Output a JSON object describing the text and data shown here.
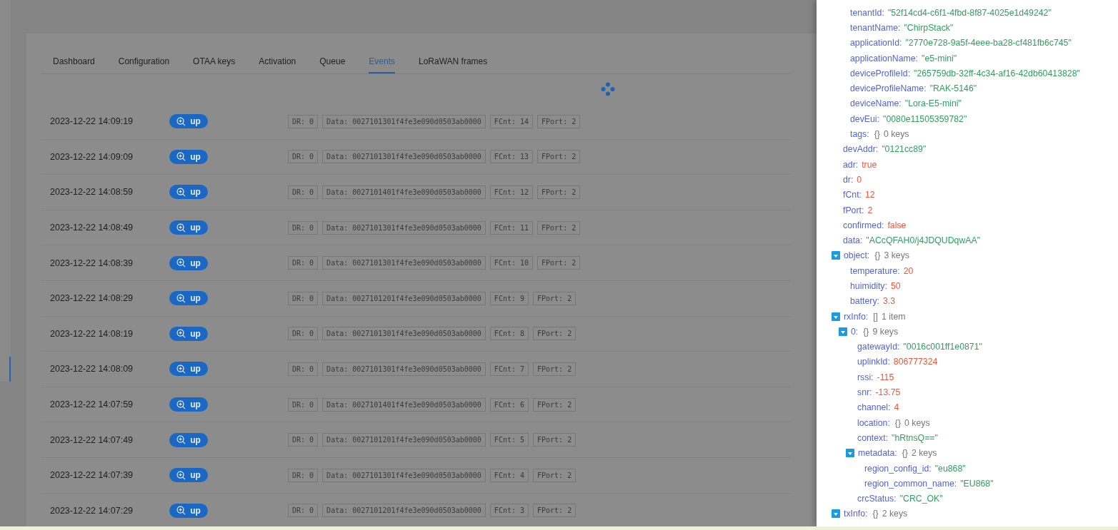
{
  "tabs": [
    {
      "label": "Dashboard",
      "selected": false
    },
    {
      "label": "Configuration",
      "selected": false
    },
    {
      "label": "OTAA keys",
      "selected": false
    },
    {
      "label": "Activation",
      "selected": false
    },
    {
      "label": "Queue",
      "selected": false
    },
    {
      "label": "Events",
      "selected": true
    },
    {
      "label": "LoRaWAN frames",
      "selected": false
    }
  ],
  "events": [
    {
      "time": "2023-12-22 14:09:19",
      "type": "up",
      "tags": [
        "DR: 0",
        "Data: 0027101301f4fe3e090d0503ab0000",
        "FCnt: 14",
        "FPort: 2"
      ]
    },
    {
      "time": "2023-12-22 14:09:09",
      "type": "up",
      "tags": [
        "DR: 0",
        "Data: 0027101301f4fe3e090d0503ab0000",
        "FCnt: 13",
        "FPort: 2"
      ]
    },
    {
      "time": "2023-12-22 14:08:59",
      "type": "up",
      "tags": [
        "DR: 0",
        "Data: 0027101401f4fe3e090d0503ab0000",
        "FCnt: 12",
        "FPort: 2"
      ]
    },
    {
      "time": "2023-12-22 14:08:49",
      "type": "up",
      "tags": [
        "DR: 0",
        "Data: 0027101301f4fe3e090d0503ab0000",
        "FCnt: 11",
        "FPort: 2"
      ]
    },
    {
      "time": "2023-12-22 14:08:39",
      "type": "up",
      "tags": [
        "DR: 0",
        "Data: 0027101301f4fe3e090d0503ab0000",
        "FCnt: 10",
        "FPort: 2"
      ]
    },
    {
      "time": "2023-12-22 14:08:29",
      "type": "up",
      "tags": [
        "DR: 0",
        "Data: 0027101201f4fe3e090d0503ab0000",
        "FCnt: 9",
        "FPort: 2"
      ]
    },
    {
      "time": "2023-12-22 14:08:19",
      "type": "up",
      "tags": [
        "DR: 0",
        "Data: 0027101301f4fe3e090d0503ab0000",
        "FCnt: 8",
        "FPort: 2"
      ]
    },
    {
      "time": "2023-12-22 14:08:09",
      "type": "up",
      "tags": [
        "DR: 0",
        "Data: 0027101301f4fe3e090d0503ab0000",
        "FCnt: 7",
        "FPort: 2"
      ]
    },
    {
      "time": "2023-12-22 14:07:59",
      "type": "up",
      "tags": [
        "DR: 0",
        "Data: 0027101401f4fe3e090d0503ab0000",
        "FCnt: 6",
        "FPort: 2"
      ]
    },
    {
      "time": "2023-12-22 14:07:49",
      "type": "up",
      "tags": [
        "DR: 0",
        "Data: 0027101201f4fe3e090d0503ab0000",
        "FCnt: 5",
        "FPort: 2"
      ]
    },
    {
      "time": "2023-12-22 14:07:39",
      "type": "up",
      "tags": [
        "DR: 0",
        "Data: 0027101301f4fe3e090d0503ab0000",
        "FCnt: 4",
        "FPort: 2"
      ]
    },
    {
      "time": "2023-12-22 14:07:29",
      "type": "up",
      "tags": [
        "DR: 0",
        "Data: 0027101201f4fe3e090d0503ab0000",
        "FCnt: 3",
        "FPort: 2"
      ]
    }
  ],
  "json_viewer": {
    "partial_parent_children": [
      {
        "key": "tenantId:",
        "kind": "string",
        "value": "\"52f14cd4-c6f1-4fbd-8f87-4025e1d49242\""
      },
      {
        "key": "tenantName:",
        "kind": "string",
        "value": "\"ChirpStack\""
      },
      {
        "key": "applicationId:",
        "kind": "string",
        "value": "\"2770e728-9a5f-4eee-ba28-cf481fb6c745\""
      },
      {
        "key": "applicationName:",
        "kind": "string",
        "value": "\"e5-mini\""
      },
      {
        "key": "deviceProfileId:",
        "kind": "string",
        "value": "\"265759db-32ff-4c34-af16-42db60413828\""
      },
      {
        "key": "deviceProfileName:",
        "kind": "string",
        "value": "\"RAK-5146\""
      },
      {
        "key": "deviceName:",
        "kind": "string",
        "value": "\"Lora-E5-mini\""
      },
      {
        "key": "devEui:",
        "kind": "string",
        "value": "\"0080e11505359782\""
      },
      {
        "key": "tags:",
        "kind": "object",
        "brackets": "{}",
        "count": "0 keys"
      }
    ],
    "items": [
      {
        "key": "devAddr:",
        "kind": "string",
        "value": "\"0121cc89\""
      },
      {
        "key": "adr:",
        "kind": "boolean",
        "value": "true"
      },
      {
        "key": "dr:",
        "kind": "number",
        "value": "0"
      },
      {
        "key": "fCnt:",
        "kind": "number",
        "value": "12"
      },
      {
        "key": "fPort:",
        "kind": "number",
        "value": "2"
      },
      {
        "key": "confirmed:",
        "kind": "boolean",
        "value": "false"
      },
      {
        "key": "data:",
        "kind": "string",
        "value": "\"ACcQFAH0/j4JDQUDqwAA\""
      },
      {
        "key": "object:",
        "kind": "object",
        "brackets": "{}",
        "count": "3 keys",
        "expanded": true,
        "children": [
          {
            "key": "temperature:",
            "kind": "number",
            "value": "20"
          },
          {
            "key": "huimidity:",
            "kind": "number",
            "value": "50"
          },
          {
            "key": "battery:",
            "kind": "number",
            "value": "3.3"
          }
        ]
      },
      {
        "key": "rxInfo:",
        "kind": "array",
        "brackets": "[]",
        "count": "1 item",
        "expanded": true,
        "children": [
          {
            "key": "0:",
            "kind": "object",
            "brackets": "{}",
            "count": "9 keys",
            "expanded": true,
            "children": [
              {
                "key": "gatewayId:",
                "kind": "string",
                "value": "\"0016c001ff1e0871\""
              },
              {
                "key": "uplinkId:",
                "kind": "number",
                "value": "806777324"
              },
              {
                "key": "rssi:",
                "kind": "number",
                "value": "-115"
              },
              {
                "key": "snr:",
                "kind": "number",
                "value": "-13.75"
              },
              {
                "key": "channel:",
                "kind": "number",
                "value": "4"
              },
              {
                "key": "location:",
                "kind": "object",
                "brackets": "{}",
                "count": "0 keys"
              },
              {
                "key": "context:",
                "kind": "string",
                "value": "\"hRtnsQ==\""
              },
              {
                "key": "metadata:",
                "kind": "object",
                "brackets": "{}",
                "count": "2 keys",
                "expanded": true,
                "children": [
                  {
                    "key": "region_config_id:",
                    "kind": "string",
                    "value": "\"eu868\""
                  },
                  {
                    "key": "region_common_name:",
                    "kind": "string",
                    "value": "\"EU868\""
                  }
                ]
              },
              {
                "key": "crcStatus:",
                "kind": "string",
                "value": "\"CRC_OK\""
              }
            ]
          }
        ]
      },
      {
        "key": "txInfo:",
        "kind": "object",
        "brackets": "{}",
        "count": "2 keys",
        "expanded": true
      }
    ]
  }
}
